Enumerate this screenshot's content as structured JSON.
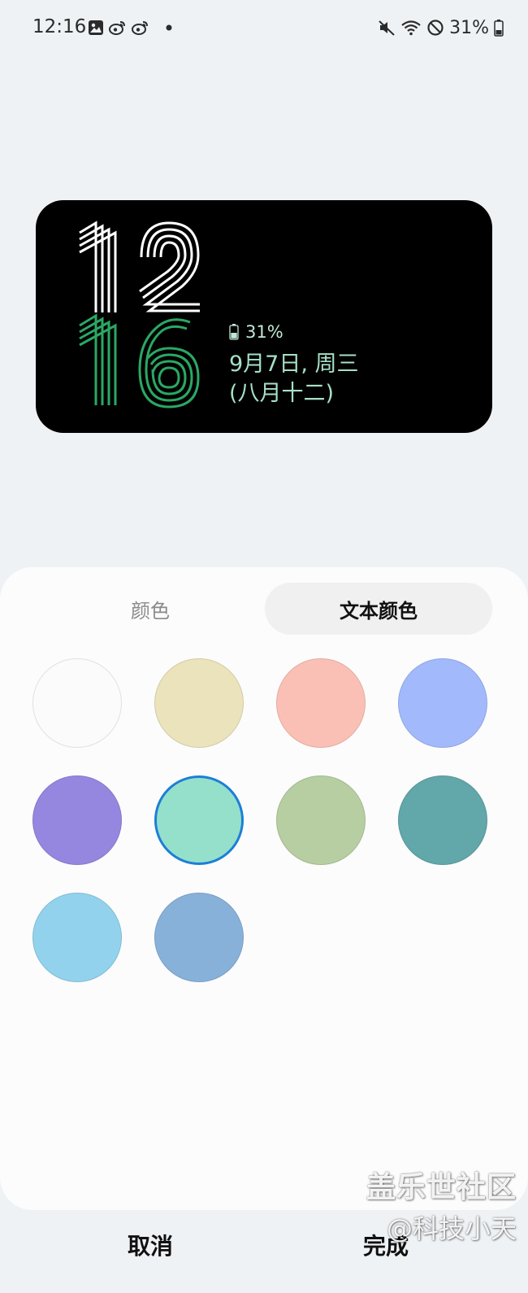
{
  "status_bar": {
    "time": "12:16",
    "battery_percent": "31%",
    "left_icons": [
      "gallery-icon",
      "weibo-icon",
      "weibo-icon",
      "dot-icon"
    ],
    "right_icons": [
      "mute-icon",
      "wifi-icon",
      "do-not-disturb-icon",
      "battery-icon"
    ]
  },
  "preview": {
    "hour": "12",
    "minute": "16",
    "battery_text": "31%",
    "date": "9月7日, 周三",
    "lunar": "(八月十二)",
    "hour_color": "#ffffff",
    "minute_color": "#2aa864",
    "info_color": "#a7e0c6"
  },
  "tabs": {
    "color": "颜色",
    "text_color": "文本颜色",
    "active": "text_color"
  },
  "swatches": {
    "colors": [
      "#fbfbfb",
      "#ebe3bc",
      "#fbc0b5",
      "#a2b9fb",
      "#9587e0",
      "#94e0cb",
      "#b6cea1",
      "#62a7aa",
      "#92d2ed",
      "#88b1da"
    ],
    "selected_index": 5
  },
  "buttons": {
    "cancel": "取消",
    "done": "完成"
  },
  "watermark": {
    "line1": "盖乐世社区",
    "line2": "@科技小天"
  }
}
